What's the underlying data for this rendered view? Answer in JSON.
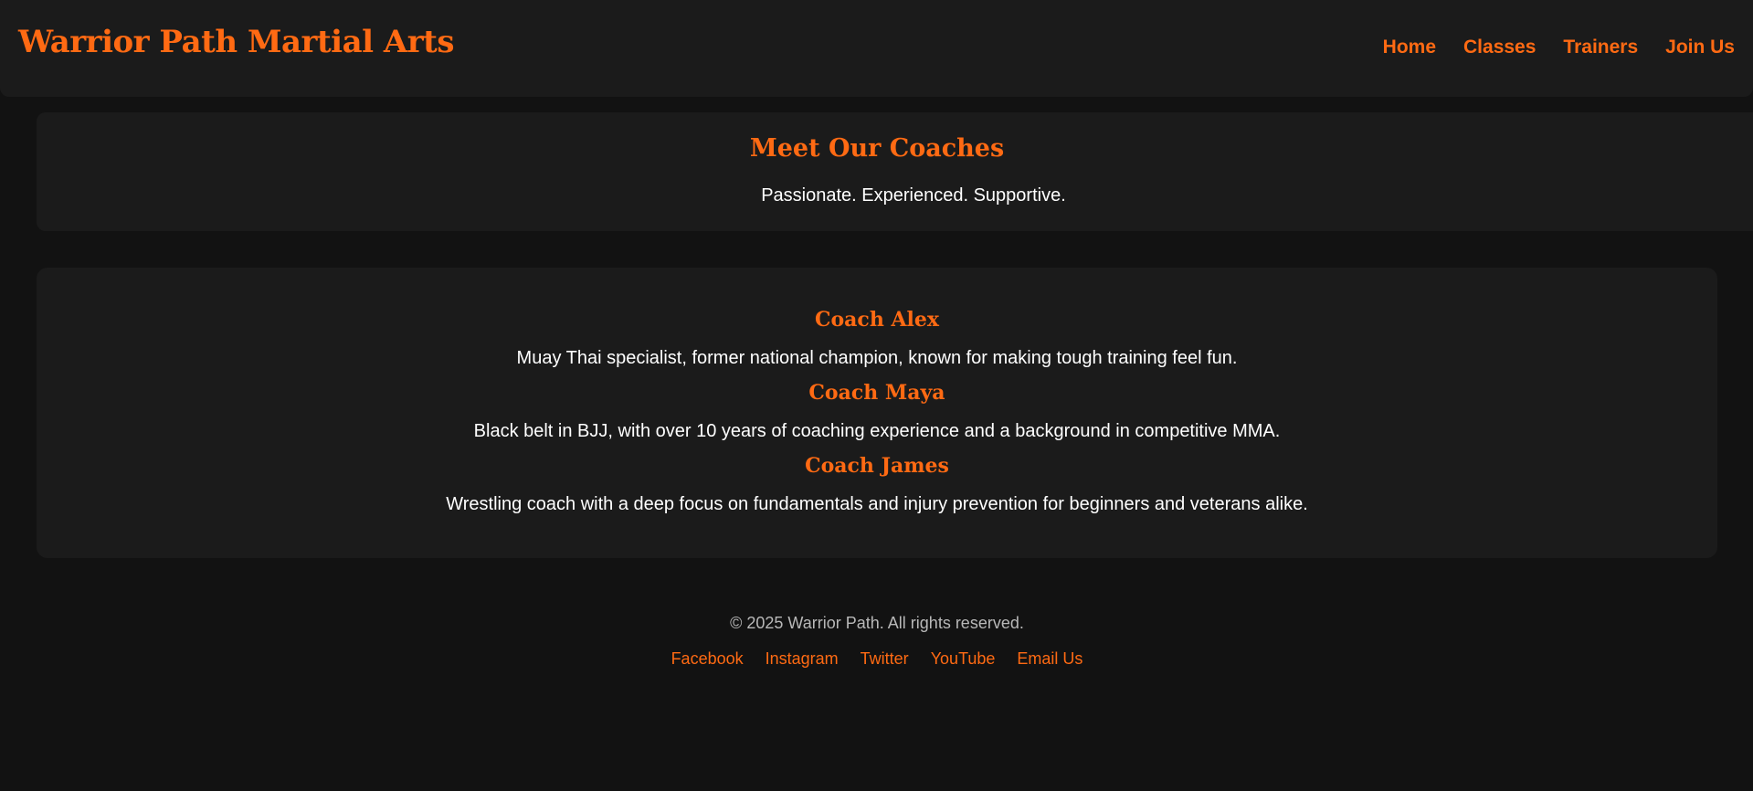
{
  "brand": {
    "name": "Warrior Path Martial Arts",
    "accent_color": "#ff6a13"
  },
  "nav": {
    "items": [
      {
        "label": "Home"
      },
      {
        "label": "Classes"
      },
      {
        "label": "Trainers"
      },
      {
        "label": "Join Us"
      }
    ]
  },
  "hero": {
    "title": "Meet Our Coaches",
    "tagline": "Passionate. Experienced. Supportive."
  },
  "coaches": [
    {
      "name": "Coach Alex",
      "bio": "Muay Thai specialist, former national champion, known for making tough training feel fun."
    },
    {
      "name": "Coach Maya",
      "bio": "Black belt in BJJ, with over 10 years of coaching experience and a background in competitive MMA."
    },
    {
      "name": "Coach James",
      "bio": "Wrestling coach with a deep focus on fundamentals and injury prevention for beginners and veterans alike."
    }
  ],
  "footer": {
    "copyright": "© 2025 Warrior Path. All rights reserved.",
    "links": [
      {
        "label": "Facebook"
      },
      {
        "label": "Instagram"
      },
      {
        "label": "Twitter"
      },
      {
        "label": "YouTube"
      },
      {
        "label": "Email Us"
      }
    ]
  }
}
